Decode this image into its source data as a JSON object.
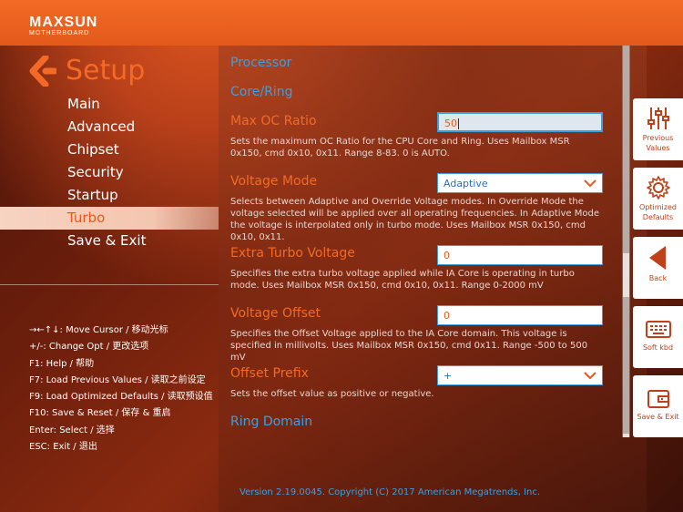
{
  "logo": {
    "brand": "MAXSUN",
    "sub": "MOTHERBOARD"
  },
  "setup": {
    "title": "Setup"
  },
  "menu": [
    {
      "label": "Main",
      "active": false
    },
    {
      "label": "Advanced",
      "active": false
    },
    {
      "label": "Chipset",
      "active": false
    },
    {
      "label": "Security",
      "active": false
    },
    {
      "label": "Startup",
      "active": false
    },
    {
      "label": "Turbo",
      "active": true
    },
    {
      "label": "Save & Exit",
      "active": false
    }
  ],
  "help": [
    "→←↑↓: Move Cursor  /  移动光标",
    "+/-: Change Opt  /  更改选项",
    "F1: Help  /  帮助",
    "F7: Load Previous Values  /  读取之前设定",
    "F9: Load Optimized Defaults  /  读取预设值",
    "F10: Save & Reset  /  保存 & 重启",
    "Enter: Select  /  选择",
    "ESC: Exit  /  退出"
  ],
  "content": {
    "processor": "Processor",
    "core_ring": "Core/Ring",
    "max_oc": {
      "title": "Max OC Ratio",
      "value": "50",
      "desc": "Sets the maximum OC Ratio for the CPU Core and Ring. Uses Mailbox MSR 0x150, cmd 0x10, 0x11. Range 8-83. 0 is AUTO."
    },
    "voltage_mode": {
      "title": "Voltage Mode",
      "value": "Adaptive",
      "desc": "Selects between Adaptive and Override Voltage modes. In Override Mode the voltage selected will be applied over all operating frequencies. In Adaptive Mode the voltage is interpolated only in turbo mode. Uses Mailbox MSR 0x150, cmd 0x10, 0x11."
    },
    "extra_turbo": {
      "title": "Extra Turbo Voltage",
      "value": "0",
      "desc": "Specifies the extra turbo voltage applied while IA Core is operating in turbo mode. Uses Mailbox MSR 0x150, cmd 0x10, 0x11. Range 0-2000 mV"
    },
    "voltage_offset": {
      "title": "Voltage Offset",
      "value": "0",
      "desc": "Specifies the Offset Voltage applied to the IA Core domain. This voltage is specified in millivolts. Uses Mailbox MSR 0x150, cmd 0x11. Range -500 to 500 mV"
    },
    "offset_prefix": {
      "title": "Offset Prefix",
      "value": "+",
      "desc": "Sets the offset value as positive or negative."
    },
    "ring_domain": "Ring Domain"
  },
  "footer": "Version 2.19.0045. Copyright (C) 2017 American Megatrends, Inc.",
  "right_buttons": {
    "previous": "Previous Values",
    "optimized": "Optimized Defaults",
    "back": "Back",
    "softkbd": "Soft kbd",
    "save_exit": "Save & Exit"
  },
  "colors": {
    "accent": "#f26a25",
    "link": "#3aa0e0"
  }
}
